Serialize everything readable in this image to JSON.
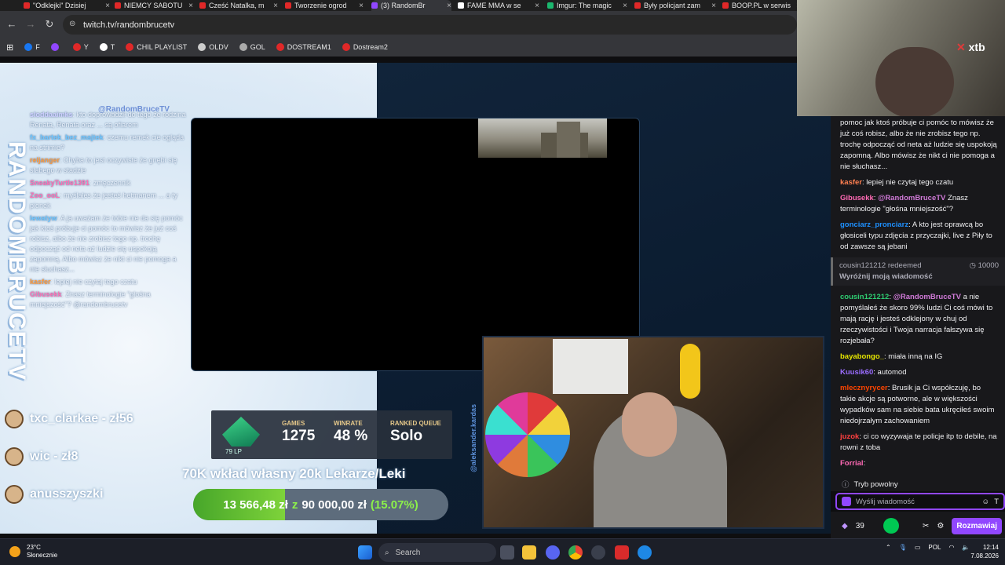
{
  "browser": {
    "tabs": [
      {
        "label": "\"Odklejki\" Dzisiej",
        "color": "#e02828"
      },
      {
        "label": "NIEMCY SABOTU",
        "color": "#e02828"
      },
      {
        "label": "Cześć Natalka, m",
        "color": "#e02828"
      },
      {
        "label": "Tworzenie ogrod",
        "color": "#e02828"
      },
      {
        "label": "(3) RandomBr",
        "color": "#9147ff"
      },
      {
        "label": "FAME MMA w se",
        "color": "#ffffff"
      },
      {
        "label": "Imgur: The magic",
        "color": "#1bb76e"
      },
      {
        "label": "Były policjant zam",
        "color": "#e02828"
      },
      {
        "label": "BOOP.PL w serwis",
        "color": "#e02828"
      }
    ],
    "url": "twitch.tv/randombrucetv",
    "bookmarks": [
      {
        "label": "F",
        "color": "#1877f2"
      },
      {
        "label": "",
        "color": "#9147ff"
      },
      {
        "label": "Y",
        "color": "#e02828"
      },
      {
        "label": "T",
        "color": "#ffffff"
      },
      {
        "label": "CHIL PLAYLIST",
        "color": "#e02828"
      },
      {
        "label": "OLDV",
        "color": "#cccccc"
      },
      {
        "label": "GOL",
        "color": "#aaaaaa"
      },
      {
        "label": "DOSTREAM1",
        "color": "#e02828"
      },
      {
        "label": "Dostream2",
        "color": "#e02828"
      }
    ]
  },
  "stream": {
    "vertical_name": "RANDOMBRUCETV",
    "overlay_tag": "@RandomBruceTV",
    "overlay_chat": [
      {
        "user": "sloddaaimks",
        "text": "kto doprowadził do tego że rodzina Renata, Renata oraz ... są ofiarem",
        "color": "#d0d0ff"
      },
      {
        "user": "fx_bartek_bez_majtek",
        "text": "czemu remek cie ogląda na strimie?",
        "color": "#6ec6ff"
      },
      {
        "user": "reljanger",
        "text": "Chyba to jest oczywiste że gnębi się słabego w stadzie",
        "color": "#ff9a3a"
      },
      {
        "user": "SneakyTurtle1391",
        "text": "zmęczennik",
        "color": "#ff6fb4"
      },
      {
        "user": "Zoo_ooL",
        "text": "myślałes że jesteś hetmanem ... a ty pionek",
        "color": "#ff6fb4"
      },
      {
        "user": "lewatyw",
        "text": "A ja uważam że tobie nie da się pomóc jak ktoś próbuje ci pomóc to mówisz że już coś robisz, albo że nie zrobisz tego np. trochę odpocząć od neta aż ludzie się uspokoją zapomną. Albo mówisz że nikt ci nie pomoga a nie słuchasz...",
        "color": "#6ec6ff"
      },
      {
        "user": "kasfer",
        "text": "lepiej nie czytaj tego czatu",
        "color": "#ff9a3a"
      },
      {
        "user": "Gibusekk",
        "text": "Znasz terminologie \"głośna mniejszość\"? @randombrucetv",
        "color": "#ff6fb4"
      }
    ],
    "subs": [
      {
        "text": "txc_clarkae - zł56"
      },
      {
        "text": "wic - zł8"
      },
      {
        "text": "anusszyszki"
      }
    ],
    "rank": {
      "lp": "79 LP",
      "games_label": "GAMES",
      "games_value": "1275",
      "winrate_label": "WINRATE",
      "winrate_value": "48 %",
      "queue_label": "RANKED QUEUE",
      "queue_value": "Solo"
    },
    "goal_title": "70K wkład własny 20k Lekarze/Leki",
    "goal": {
      "current": "13 566,48 zł",
      "sep": "z",
      "target": "90 000,00 zł",
      "percent": "(15.07%)",
      "fraction": 0.1507
    },
    "cam_tag": "@aleksander.kardas"
  },
  "xtb": {
    "logo_x": "✕",
    "logo_text": "xtb"
  },
  "chat": {
    "messages": [
      {
        "user": "",
        "text": "pomoc jak ktoś próbuje ci pomóc to mówisz że już coś robisz, albo że nie zrobisz tego np. trochę odpocząć od neta aż ludzie się uspokoją zapomną. Albo mówisz że nikt ci nie pomoga a nie słuchasz...",
        "color": "#efeff1"
      },
      {
        "user": "kasfer",
        "text": "lepiej nie czytaj tego czatu",
        "color": "#ff7f50"
      },
      {
        "user": "Gibusekk",
        "text": "Znasz terminologie \"głośna mniejszość\"?",
        "mention": "@RandomBruceTV",
        "color": "#ff69b4"
      },
      {
        "user": "gonciarz_pronciarz",
        "text": "A kto jest oprawcą bo głosiceli typu zdjęcia z przyczajki, live z Piły to od zawsze są jebani",
        "color": "#1e90ff"
      }
    ],
    "redeem": {
      "user": "cousin121212",
      "action": "redeemed",
      "cost": "10000",
      "message": "Wyróżnij moją wiadomość"
    },
    "messages2": [
      {
        "user": "cousin121212",
        "mention": "@RandomBruceTV",
        "text": "a nie pomyślałeś że skoro 99% ludzi Ci coś mówi to mają rację i jesteś odklejony w chuj od rzeczywistości i Twoja narracja fałszywa się rozjebała?",
        "color": "#2ecc71"
      },
      {
        "user": "bayabongo_",
        "text": "miała inną na IG",
        "color": "#e6e600"
      },
      {
        "user": "Kuusik60",
        "text": "automod",
        "color": "#9a6cff"
      },
      {
        "user": "mlecznyrycer",
        "text": "Brusik ja Ci współczuję, bo takie akcje są potworne, ale w większości wypadków sam na siebie bata ukręciłeś swoim niedojrzałym zachowaniem",
        "color": "#ff4500"
      },
      {
        "user": "juzok",
        "text": "ci co wyzywaja te policje itp to debile, na rowni z toba",
        "color": "#ff4040"
      },
      {
        "user": "Forrial",
        "text": "",
        "color": "#ff69b4"
      }
    ],
    "slow_mode": "Tryb powolny",
    "input_placeholder": "Wyślij wiadomość",
    "points": "39",
    "chat_button": "Rozmawiaj"
  },
  "taskbar": {
    "temp": "23°C",
    "weather": "Słonecznie",
    "search": "Search",
    "lang": "POL",
    "time": "12:14",
    "date": "7.08.2026"
  }
}
